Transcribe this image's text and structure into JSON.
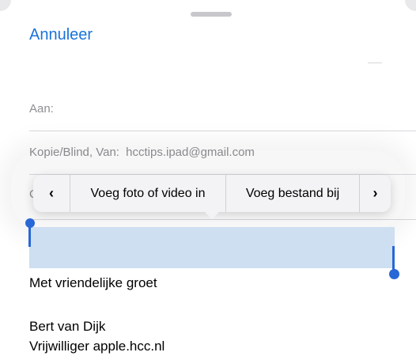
{
  "compose": {
    "cancel_label": "Annuleer",
    "to_label": "Aan:",
    "cc_bcc_from_label": "Kopie/Blind, Van:",
    "from_email": "hcctips.ipad@gmail.com",
    "subject_label_partial": "O"
  },
  "context_menu": {
    "prev_icon": "chevron-left-icon",
    "insert_media_label": "Voeg foto of video in",
    "attach_file_label": "Voeg bestand bij",
    "next_icon": "chevron-right-icon"
  },
  "body": {
    "greeting": "Met vriendelijke groet",
    "name": "Bert van Dijk",
    "role": "Vrijwilliger apple.hcc.nl"
  },
  "colors": {
    "accent": "#1a73d9",
    "selection": "#cddff0",
    "handle": "#2867d6"
  }
}
